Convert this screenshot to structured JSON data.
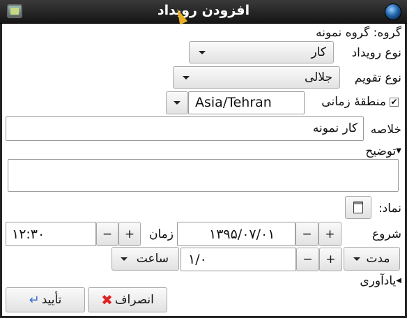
{
  "window": {
    "title": "افزودن رویداد"
  },
  "group_label": "گروه: گروه نمونه",
  "event_type": {
    "label": "نوع رویداد",
    "value": "کار"
  },
  "calendar_type": {
    "label": "نوع تقویم",
    "value": "جلالی"
  },
  "timezone": {
    "label": "منطقهٔ زمانی",
    "value": "Asia/Tehran",
    "checked": true
  },
  "summary": {
    "label": "خلاصه",
    "value": "کار نمونه"
  },
  "description": {
    "label": "توضیح",
    "value": ""
  },
  "icon_row": {
    "label": "نماد:"
  },
  "start": {
    "label": "شروع",
    "date": "۱۳۹۵/۰۷/۰۱",
    "time_label": "زمان",
    "time": "۱۲:۳۰",
    "plus": "+",
    "minus": "−"
  },
  "duration": {
    "label": "مدت",
    "value": "۱/۰",
    "unit": "ساعت",
    "plus": "+",
    "minus": "−"
  },
  "reminder": {
    "label": "یادآوری"
  },
  "buttons": {
    "cancel": "انصراف",
    "ok": "تأیید"
  }
}
